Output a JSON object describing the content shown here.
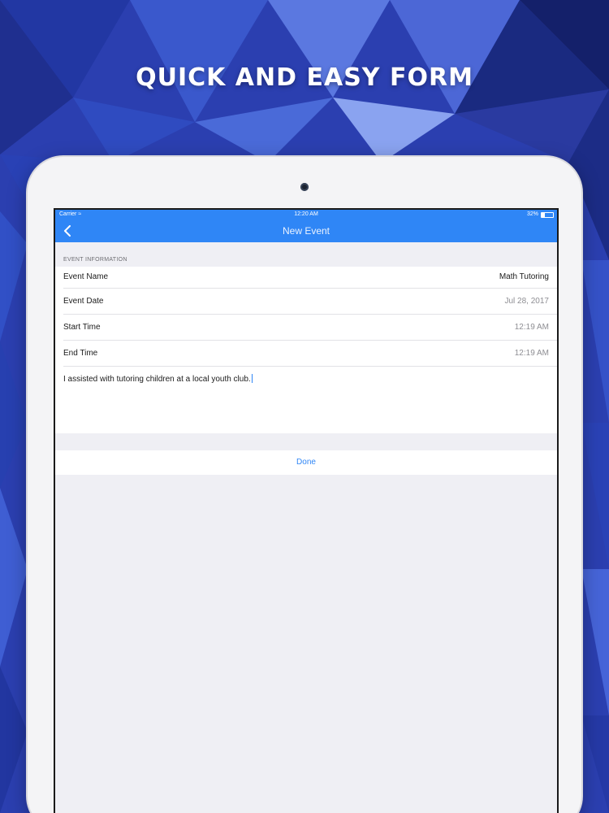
{
  "headline": "QUICK AND EASY FORM",
  "status_bar": {
    "carrier": "Carrier",
    "time": "12:20 AM",
    "battery_text": "32%",
    "battery_level": 0.32
  },
  "nav": {
    "back_icon": "chevron-left-icon",
    "title": "New Event"
  },
  "form": {
    "section_header": "EVENT INFORMATION",
    "rows": [
      {
        "label": "Event Name",
        "value": "Math Tutoring"
      },
      {
        "label": "Event Date",
        "value": "Jul 28, 2017"
      },
      {
        "label": "Start Time",
        "value": "12:19 AM"
      },
      {
        "label": "End Time",
        "value": "12:19 AM"
      }
    ],
    "notes": "I assisted with tutoring children at a local youth club."
  },
  "done_label": "Done",
  "colors": {
    "accent": "#2f86f6",
    "background": "#efeff4",
    "backdrop": "#2c44b8"
  }
}
